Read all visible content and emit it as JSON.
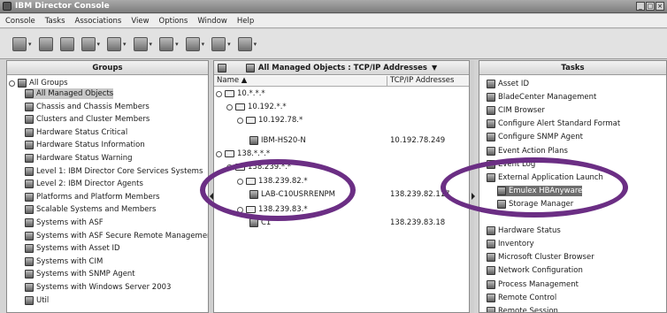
{
  "window": {
    "title": "IBM Director Console"
  },
  "menu": [
    "Console",
    "Tasks",
    "Associations",
    "View",
    "Options",
    "Window",
    "Help"
  ],
  "toolbar": {
    "buttons": [
      "wrench-icon",
      "refresh-icon",
      "lock-icon",
      "gear-icon",
      "console-icon",
      "zoom-icon",
      "monitor-icon",
      "tree-icon",
      "network-icon",
      "server-icon"
    ]
  },
  "groups": {
    "title": "Groups",
    "root": "All Groups",
    "items": [
      "All Managed Objects",
      "Chassis and Chassis Members",
      "Clusters and Cluster Members",
      "Hardware Status Critical",
      "Hardware Status Information",
      "Hardware Status Warning",
      "Level 1: IBM Director Core Services Systems",
      "Level 2: IBM Director Agents",
      "Platforms and Platform Members",
      "Scalable Systems and Members",
      "Systems with ASF",
      "Systems with ASF Secure Remote Management",
      "Systems with Asset ID",
      "Systems with CIM",
      "Systems with SNMP Agent",
      "Systems with Windows Server 2003",
      "Util"
    ]
  },
  "managed": {
    "title": "All Managed Objects : TCP/IP Addresses",
    "col_name": "Name ▲",
    "col_ip": "TCP/IP Addresses",
    "rows": [
      {
        "name": "10.*.*.*",
        "ip": ""
      },
      {
        "name": "10.192.*.*",
        "ip": ""
      },
      {
        "name": "10.192.78.*",
        "ip": ""
      },
      {
        "name": "IBM-HS20-N",
        "ip": "10.192.78.249"
      },
      {
        "name": "138.*.*.*",
        "ip": ""
      },
      {
        "name": "138.239.*.*",
        "ip": ""
      },
      {
        "name": "138.239.82.*",
        "ip": ""
      },
      {
        "name": "LAB-C10USRRENPM",
        "ip": "138.239.82.117"
      },
      {
        "name": "138.239.83.*",
        "ip": ""
      },
      {
        "name": "C1",
        "ip": "138.239.83.18"
      }
    ]
  },
  "tasks": {
    "title": "Tasks",
    "items": [
      "Asset ID",
      "BladeCenter Management",
      "CIM Browser",
      "Configure Alert Standard Format",
      "Configure SNMP Agent",
      "Event Action Plans",
      "Event Log",
      "External Application Launch",
      "Emulex HBAnyware",
      "Storage Manager",
      "",
      "Hardware Status",
      "Inventory",
      "Microsoft Cluster Browser",
      "Network Configuration",
      "Process Management",
      "Remote Control",
      "Remote Session"
    ]
  },
  "colors": {
    "annotation": "#6b2e84",
    "selection": "#6e6e6e"
  }
}
